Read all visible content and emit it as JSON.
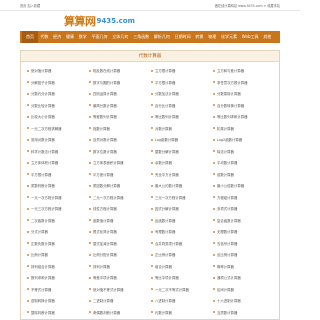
{
  "topbar": {
    "left": "首页 加入收藏",
    "right": "做在线计算网站 www.9435.com > 收藏本站"
  },
  "logo": {
    "cn": "算算网",
    "domain": "9435.com"
  },
  "nav": [
    {
      "label": "首页",
      "home": true
    },
    {
      "label": "代数"
    },
    {
      "label": "经济"
    },
    {
      "label": "健康"
    },
    {
      "label": "数学"
    },
    {
      "label": "平面几何"
    },
    {
      "label": "立体几何"
    },
    {
      "label": "三角函数"
    },
    {
      "label": "解析几何"
    },
    {
      "label": "日期时间"
    },
    {
      "label": "转换"
    },
    {
      "label": "物理"
    },
    {
      "label": "化学元素"
    },
    {
      "label": "Web工具"
    },
    {
      "label": "其他"
    }
  ],
  "panel": {
    "title": "代数计算器"
  },
  "items": [
    "绝对值计算器",
    "相反数在线计算器",
    "立方根计算器",
    "立方和与差计算器",
    "分解因子计算器",
    "数字与圆的计算器",
    "平方根计算器",
    "求任意次方根计算器",
    "分数约分计算器",
    "四则运算计算器",
    "分数加法计算器",
    "分数乘除计算器",
    "分数比较计算器",
    "最简分数计算器",
    "百分比计算器",
    "百分数转换计算器",
    "比较大小计算器",
    "等差数列计算器",
    "等比数列计算器",
    "等比数列求和计算器",
    "一元二次方程求解器",
    "指数计算器",
    "对数计算器",
    "阶乘计算器",
    "常用对数计算器",
    "自然对数计算器",
    "Log函数计算器",
    "Log2函数计算器",
    "科学计数法计算器",
    "数字位数计算器",
    "整数分解计算器",
    "除法计算器",
    "立方体体积计算器",
    "立方体表面积计算器",
    "余数计算器",
    "平均数计算器",
    "平方根计算器",
    "平方差计算器",
    "完全平方计算器",
    "倍数计算器",
    "质数判断计算器",
    "质因数分解计算器",
    "最大公约数计算器",
    "最小公倍数计算器",
    "一元一次方程计算器",
    "二元一次方程计算器",
    "三元一次方程计算器",
    "方程组计算器",
    "一元三次方程计算器",
    "线性方程计算器",
    "因式分解计算器",
    "多项式计算器",
    "二次函数计算器",
    "函数值计算器",
    "反函数计算器",
    "复合函数计算器",
    "分式计算器",
    "根式化简计算器",
    "有理数计算器",
    "无理数计算器",
    "正数负数计算器",
    "整式加减计算器",
    "合并同类项计算器",
    "去括号计算器",
    "比例计算器",
    "比例分配计算器",
    "正比例计算器",
    "反比例计算器",
    "排列组合计算器",
    "排列计算器",
    "组合计算器",
    "概率计算器",
    "数列求和计算器",
    "等差中项计算器",
    "等比中项计算器",
    "通项公式计算器",
    "不等式计算器",
    "绝对值不等式计算器",
    "一元二次不等式计算器",
    "区间计算器",
    "进制转换计算器",
    "二进制计算器",
    "八进制计算器",
    "十六进制计算器",
    "整除判断计算器",
    "奇偶数判断计算器",
    "约数计算器",
    "互质数计算器",
    "小数计算器",
    "小数化分数计算器",
    "分数化小数计算器",
    "循环小数计算器",
    "估算计算器",
    "四舍五入计算器",
    "取整计算器",
    "近似数计算器"
  ]
}
